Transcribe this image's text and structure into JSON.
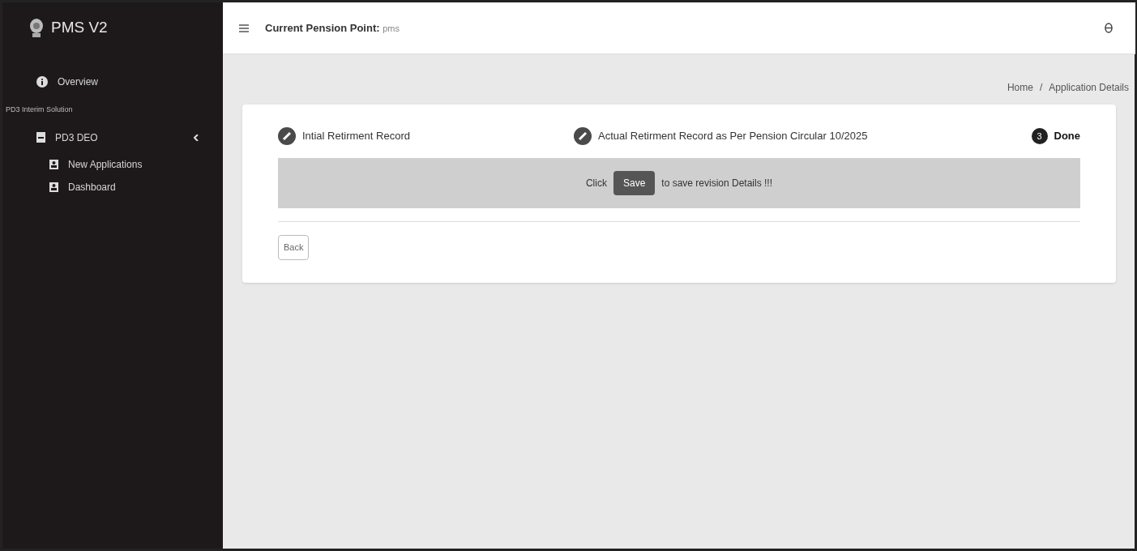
{
  "sidebar": {
    "brand": "PMS V2",
    "items": [
      {
        "kind": "link",
        "label": "Overview"
      },
      {
        "kind": "header",
        "label": "PD3 Interim Solution"
      },
      {
        "kind": "group",
        "label": "PD3 DEO",
        "expanded": true,
        "children": [
          {
            "label": "New Applications"
          },
          {
            "label": "Dashboard"
          }
        ]
      }
    ]
  },
  "header": {
    "label": "Current Pension Point:",
    "value": "pms"
  },
  "breadcrumb": {
    "separator": "/",
    "items": [
      "Home",
      "Application Details"
    ]
  },
  "steps": [
    {
      "label": "Intial Retirment Record",
      "completed": true
    },
    {
      "label": "Actual Retirment Record as Per Pension Circular 10/2025",
      "completed": true
    },
    {
      "label": "Done",
      "completed": false,
      "number": "3"
    }
  ],
  "message": {
    "before": "Click",
    "button": "Save",
    "after": "to save revision Details !!!"
  },
  "back_button": "Back"
}
